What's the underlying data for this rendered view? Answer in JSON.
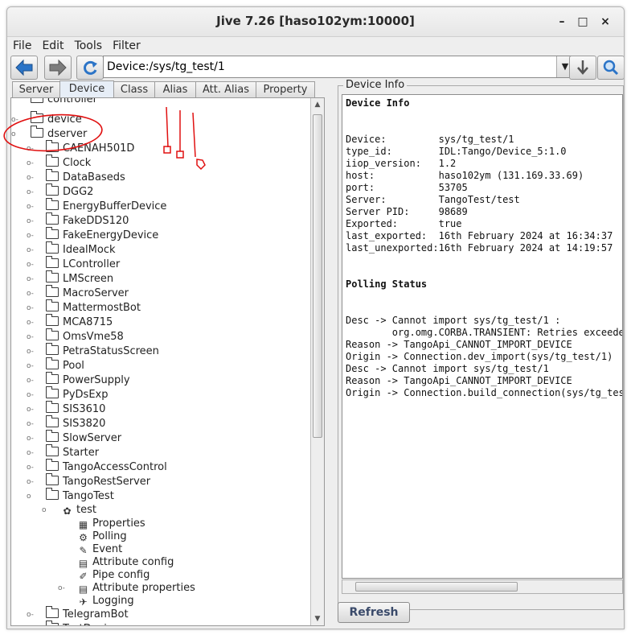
{
  "window": {
    "title": "Jive 7.26 [haso102ym:10000]",
    "minimize": "–",
    "maximize": "□",
    "close": "×"
  },
  "menu": [
    "File",
    "Edit",
    "Tools",
    "Filter"
  ],
  "toolbar": {
    "address": "Device:/sys/tg_test/1"
  },
  "tabs": [
    "Server",
    "Device",
    "Class",
    "Alias",
    "Att. Alias",
    "Property"
  ],
  "active_tab": "Device",
  "tree": {
    "partial_top": "controller",
    "device": "device",
    "dserver": "dserver",
    "servers": [
      "CAENAH501D",
      "Clock",
      "DataBaseds",
      "DGG2",
      "EnergyBufferDevice",
      "FakeDDS120",
      "FakeEnergyDevice",
      "IdealMock",
      "LController",
      "LMScreen",
      "MacroServer",
      "MattermostBot",
      "MCA8715",
      "OmsVme58",
      "PetraStatusScreen",
      "Pool",
      "PowerSupply",
      "PyDsExp",
      "SIS3610",
      "SIS3820",
      "SlowServer",
      "Starter",
      "TangoAccessControl",
      "TangoRestServer",
      "TangoTest"
    ],
    "instance": "test",
    "children": [
      "Properties",
      "Polling",
      "Event",
      "Attribute config",
      "Pipe config",
      "Attribute properties",
      "Logging"
    ],
    "after": [
      "TelegramBot",
      "TestDevice"
    ]
  },
  "info": {
    "panel_title": "Device Info",
    "heading": "Device Info",
    "fields": [
      {
        "k": "Device:",
        "v": "sys/tg_test/1"
      },
      {
        "k": "type_id:",
        "v": "IDL:Tango/Device_5:1.0"
      },
      {
        "k": "iiop_version:",
        "v": "1.2"
      },
      {
        "k": "host:",
        "v": "haso102ym (131.169.33.69)"
      },
      {
        "k": "port:",
        "v": "53705"
      },
      {
        "k": "Server:",
        "v": "TangoTest/test"
      },
      {
        "k": "Server PID:",
        "v": "98689"
      },
      {
        "k": "Exported:",
        "v": "true"
      },
      {
        "k": "last_exported:",
        "v": "16th February 2024 at 16:34:37"
      },
      {
        "k": "last_unexported:",
        "v": "16th February 2024 at 14:19:57"
      }
    ],
    "polling_heading": "Polling Status",
    "errors": [
      "Desc -> Cannot import sys/tg_test/1 :",
      "        org.omg.CORBA.TRANSIENT: Retries exceeded",
      "Reason -> TangoApi_CANNOT_IMPORT_DEVICE",
      "Origin -> Connection.dev_import(sys/tg_test/1)",
      "Desc -> Cannot import sys/tg_test/1",
      "Reason -> TangoApi_CANNOT_IMPORT_DEVICE",
      "Origin -> Connection.build_connection(sys/tg_test/"
    ]
  },
  "refresh_label": "Refresh",
  "colors": {
    "accent": "#2b74c7",
    "annotation": "#e01010"
  }
}
